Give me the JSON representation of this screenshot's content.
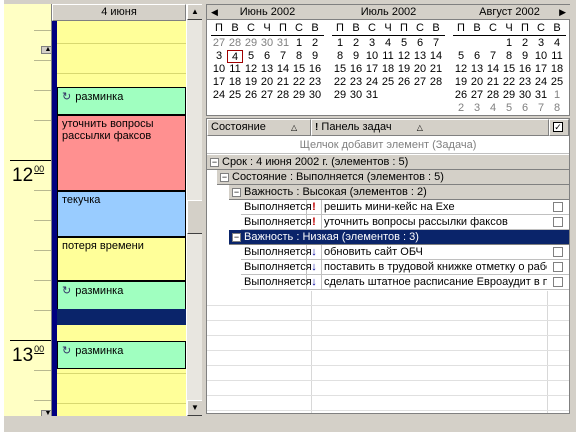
{
  "day_view": {
    "date_header": "4 июня",
    "hours": [
      "12",
      "13"
    ],
    "hour_suffix": "00",
    "appointments": [
      {
        "title": "разминка",
        "icon": "recurrence-icon",
        "color": "#a0ffc0"
      },
      {
        "title": "уточнить вопросы рассылки факсов",
        "icon": "",
        "color": "#ff9090"
      },
      {
        "title": "текучка",
        "icon": "",
        "color": "#99ccff"
      },
      {
        "title": "потеря времени",
        "icon": "",
        "color": "#ffff99"
      },
      {
        "title": "разминка",
        "icon": "recurrence-icon",
        "color": "#a0ffc0"
      },
      {
        "title": "разминка",
        "icon": "recurrence-icon",
        "color": "#a0ffc0"
      }
    ]
  },
  "navigator": {
    "weekdays": [
      "П",
      "В",
      "С",
      "Ч",
      "П",
      "С",
      "В"
    ],
    "months": [
      {
        "name": "Июнь 2002",
        "days": [
          "27",
          "28",
          "29",
          "30",
          "31",
          "1",
          "2",
          "3",
          "4",
          "5",
          "6",
          "7",
          "8",
          "9",
          "10",
          "11",
          "12",
          "13",
          "14",
          "15",
          "16",
          "17",
          "18",
          "19",
          "20",
          "21",
          "22",
          "23",
          "24",
          "25",
          "26",
          "27",
          "28",
          "29",
          "30"
        ],
        "lead_gray": 5,
        "today": "4"
      },
      {
        "name": "Июль 2002",
        "days": [
          "1",
          "2",
          "3",
          "4",
          "5",
          "6",
          "7",
          "8",
          "9",
          "10",
          "11",
          "12",
          "13",
          "14",
          "15",
          "16",
          "17",
          "18",
          "19",
          "20",
          "21",
          "22",
          "23",
          "24",
          "25",
          "26",
          "27",
          "28",
          "29",
          "30",
          "31"
        ],
        "lead_gray": 0,
        "today": ""
      },
      {
        "name": "Август 2002",
        "days": [
          "",
          "",
          "",
          "1",
          "2",
          "3",
          "4",
          "5",
          "6",
          "7",
          "8",
          "9",
          "10",
          "11",
          "12",
          "13",
          "14",
          "15",
          "16",
          "17",
          "18",
          "19",
          "20",
          "21",
          "22",
          "23",
          "24",
          "25",
          "26",
          "27",
          "28",
          "29",
          "30",
          "31",
          "1",
          "2",
          "3",
          "4",
          "5",
          "6",
          "7",
          "8"
        ],
        "lead_gray": 0,
        "trail_gray_from": 34,
        "today": ""
      }
    ]
  },
  "tasks": {
    "header_status": "Состояние",
    "header_panel": "Панель задач",
    "add_placeholder": "Щелчок добавит элемент (Задача)",
    "group_due": "Срок : 4 июня 2002 г. (элементов : 5)",
    "group_status": "Состояние : Выполняется (элементов : 5)",
    "group_high": "Важность : Высокая (элементов : 2)",
    "group_low": "Важность : Низкая (элементов : 3)",
    "rows": [
      {
        "status": "Выполняется",
        "priority": "!",
        "subject": "решить мини-кейс на Exe"
      },
      {
        "status": "Выполняется",
        "priority": "!",
        "subject": "уточнить вопросы рассылки факсов"
      },
      {
        "status": "Выполняется",
        "priority": "↓",
        "subject": "обновить сайт ОБЧ"
      },
      {
        "status": "Выполняется",
        "priority": "↓",
        "subject": "поставить в трудовой книжке отметку о работе в..."
      },
      {
        "status": "Выполняется",
        "priority": "↓",
        "subject": "сделать штатное расписание Евроаудит в прило..."
      }
    ]
  }
}
